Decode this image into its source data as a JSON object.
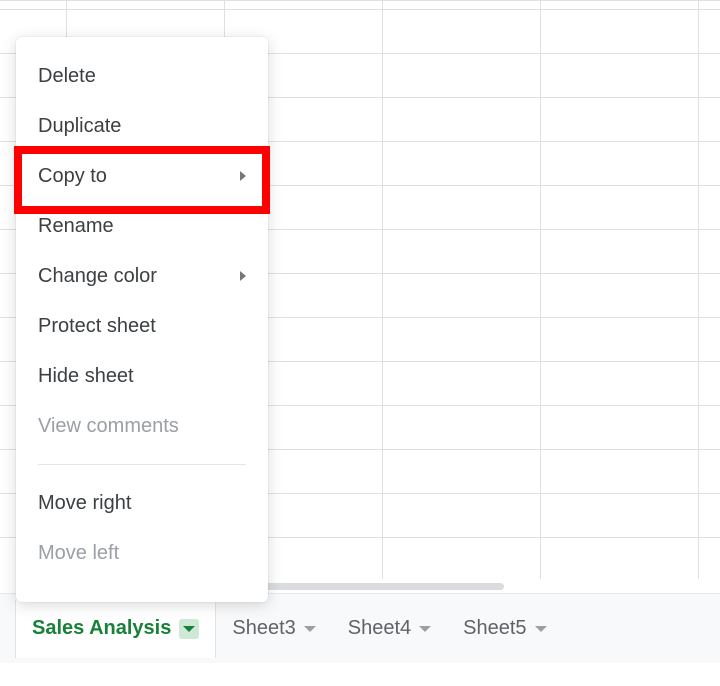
{
  "context_menu": {
    "items": [
      {
        "label": "Delete",
        "has_submenu": false,
        "disabled": false
      },
      {
        "label": "Duplicate",
        "has_submenu": false,
        "disabled": false
      },
      {
        "label": "Copy to",
        "has_submenu": true,
        "disabled": false,
        "highlighted": true
      },
      {
        "label": "Rename",
        "has_submenu": false,
        "disabled": false
      },
      {
        "label": "Change color",
        "has_submenu": true,
        "disabled": false
      },
      {
        "label": "Protect sheet",
        "has_submenu": false,
        "disabled": false
      },
      {
        "label": "Hide sheet",
        "has_submenu": false,
        "disabled": false
      },
      {
        "label": "View comments",
        "has_submenu": false,
        "disabled": true
      },
      {
        "separator": true
      },
      {
        "label": "Move right",
        "has_submenu": false,
        "disabled": false
      },
      {
        "label": "Move left",
        "has_submenu": false,
        "disabled": true
      }
    ]
  },
  "sheet_tabs": {
    "active_index": 0,
    "tabs": [
      {
        "label": "Sales Analysis"
      },
      {
        "label": "Sheet3"
      },
      {
        "label": "Sheet4"
      },
      {
        "label": "Sheet5"
      }
    ]
  },
  "colors": {
    "active_tab_text": "#188038",
    "active_tab_caret_bg": "#ceead6",
    "highlight_border": "#ff0000"
  }
}
